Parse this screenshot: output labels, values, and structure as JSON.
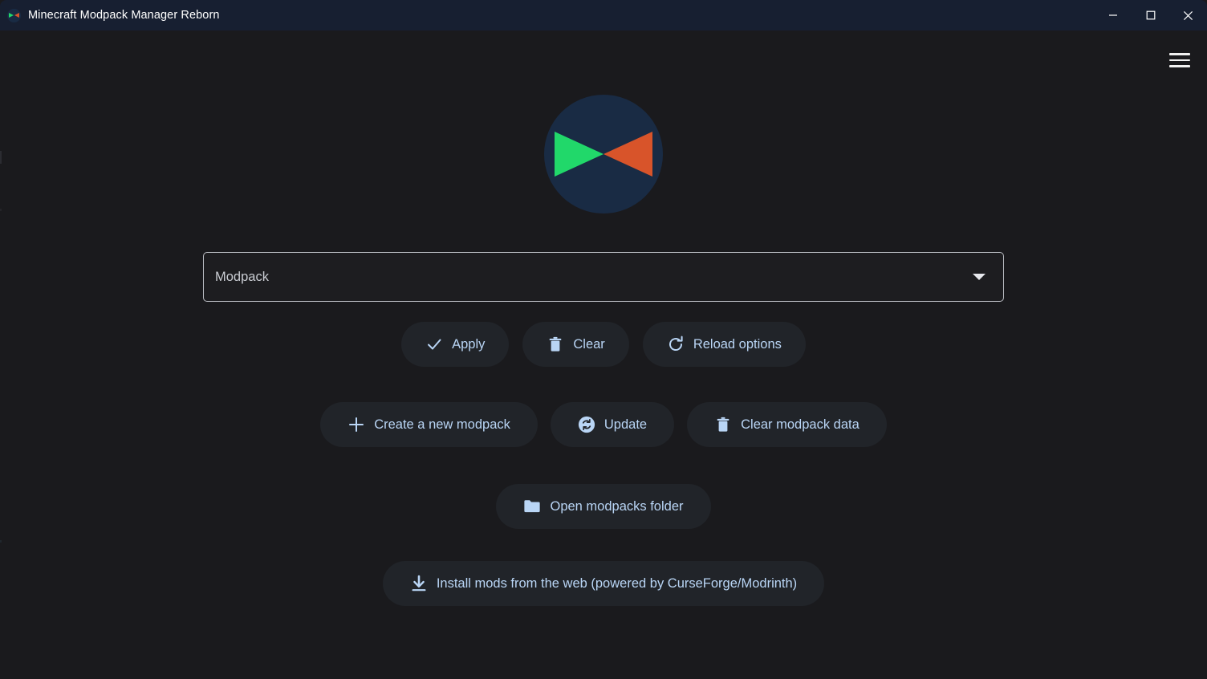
{
  "window": {
    "title": "Minecraft Modpack Manager Reborn",
    "app_icon": "modpack-manager-logo-icon",
    "controls": {
      "minimize": "minimize-icon",
      "maximize": "maximize-icon",
      "close": "close-icon"
    }
  },
  "colors": {
    "background": "#1a1a1d",
    "titlebar": "#171f31",
    "button_fill": "#212429",
    "button_text": "#b9d5f5",
    "logo_circle": "#192b44",
    "logo_green": "#21d86a",
    "logo_orange": "#d8542a",
    "field_border": "#b9bcc2",
    "field_text": "#c9ccd2"
  },
  "menu": {
    "hamburger_label": "menu-icon"
  },
  "logo": {
    "name": "app-logo"
  },
  "modpack_select": {
    "value": "Modpack",
    "placeholder": "Modpack",
    "caret": "chevron-down-icon"
  },
  "actions": {
    "row1": [
      {
        "label": "Apply",
        "icon": "check-icon"
      },
      {
        "label": "Clear",
        "icon": "trash-icon"
      },
      {
        "label": "Reload options",
        "icon": "refresh-icon"
      }
    ],
    "row2": [
      {
        "label": "Create a new modpack",
        "icon": "plus-icon"
      },
      {
        "label": "Update",
        "icon": "sync-circle-icon"
      },
      {
        "label": "Clear modpack data",
        "icon": "trash-icon"
      }
    ],
    "row3": [
      {
        "label": "Open modpacks folder",
        "icon": "folder-icon"
      }
    ],
    "row4": [
      {
        "label": "Install mods from the web (powered by CurseForge/Modrinth)",
        "icon": "download-icon"
      }
    ]
  }
}
